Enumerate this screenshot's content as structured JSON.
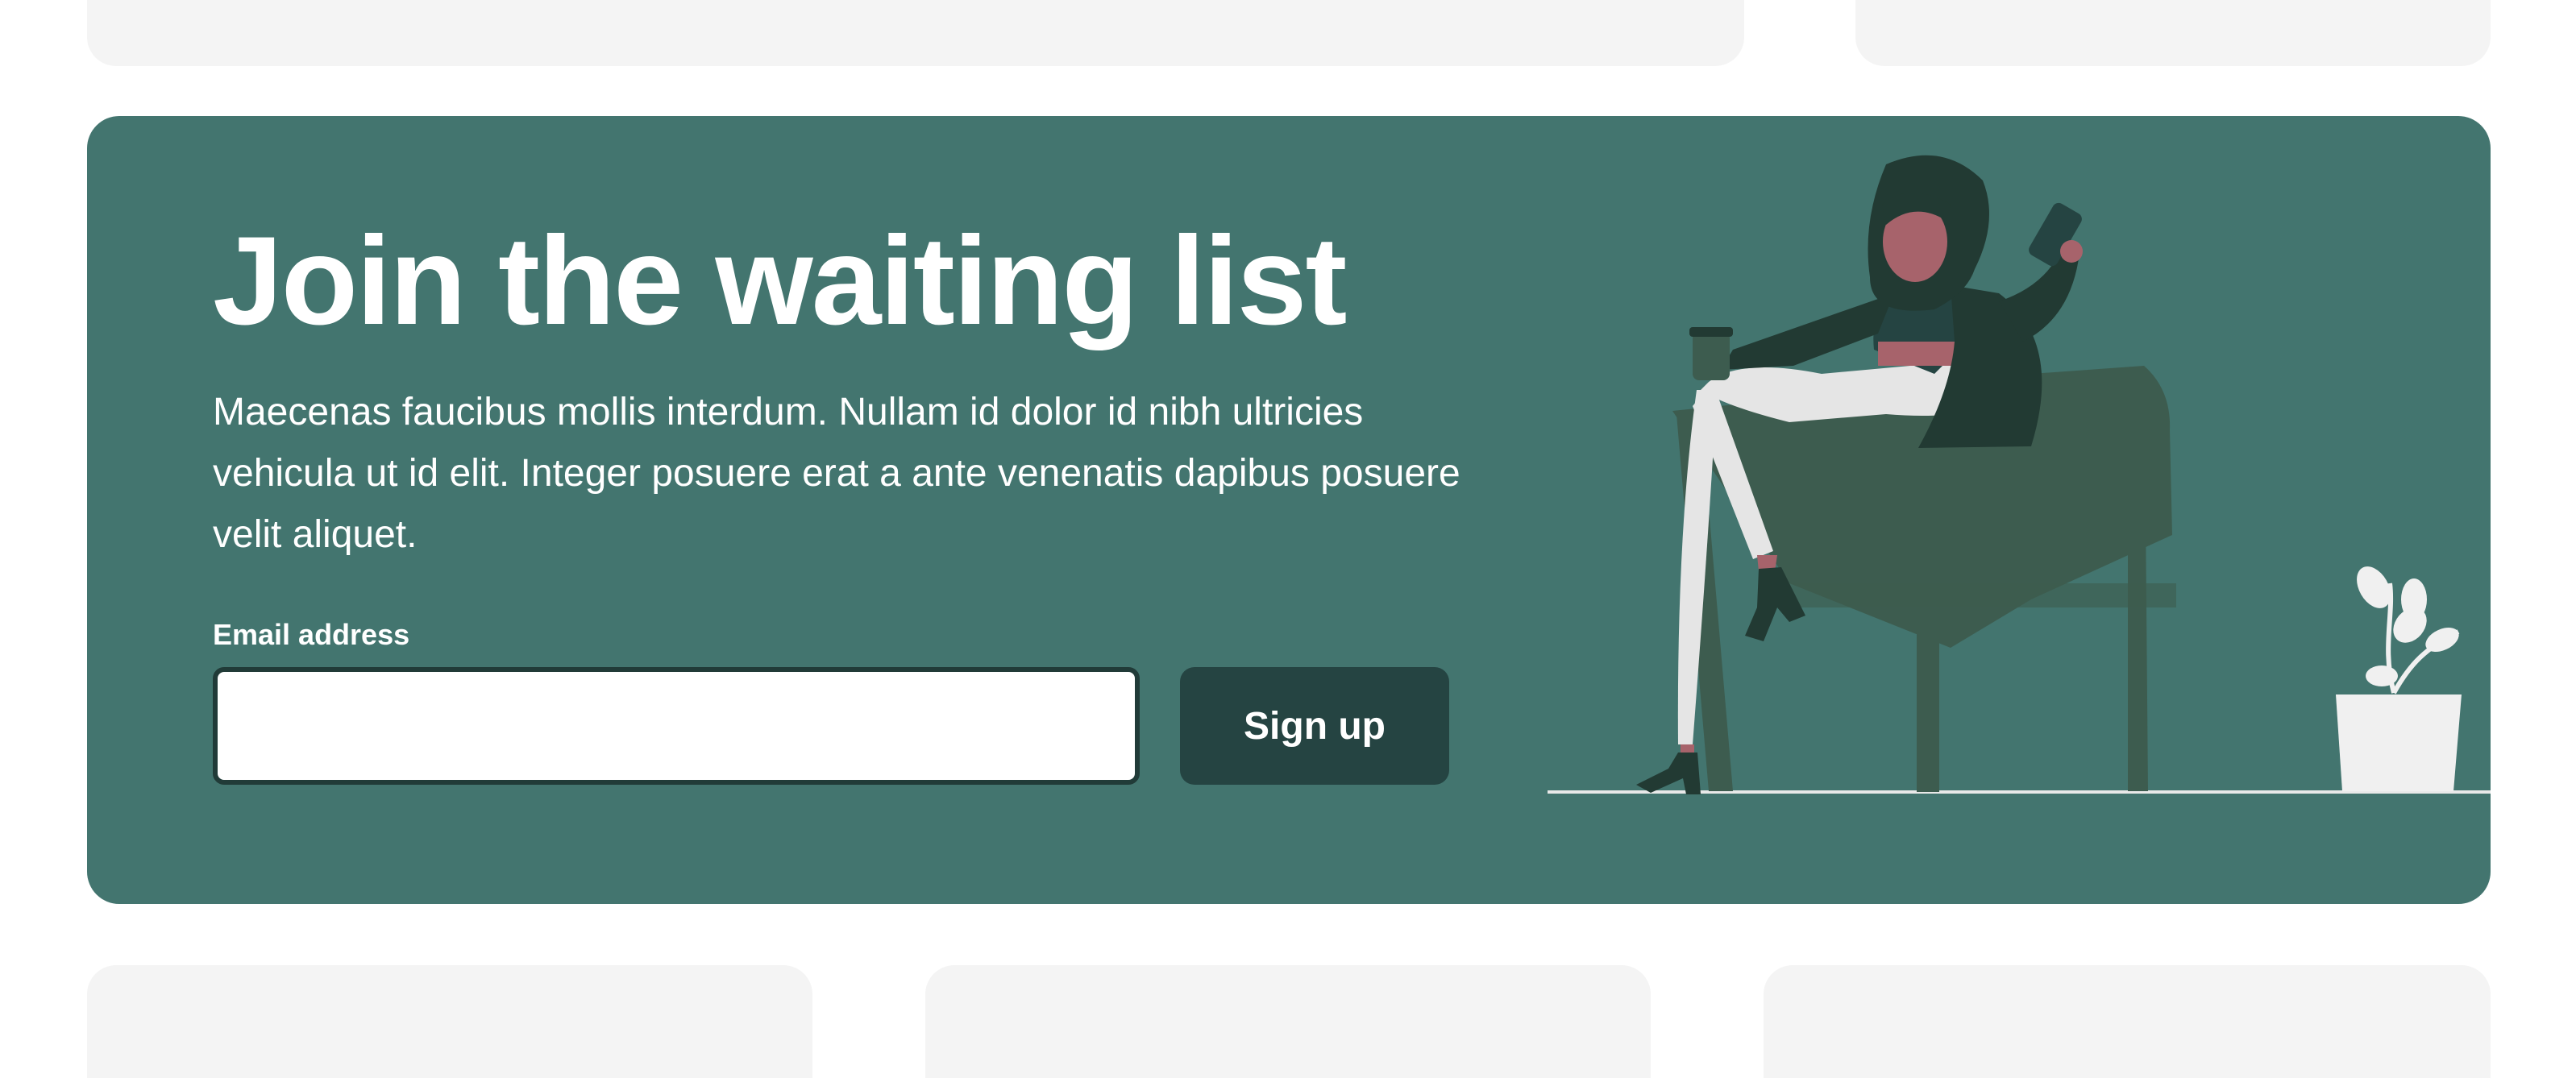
{
  "banner": {
    "title": "Join the waiting list",
    "description": "Maecenas faucibus mollis interdum. Nullam id dolor id nibh ultricies vehicula ut id elit. Integer posuere erat a ante venenatis dapibus posuere velit aliquet.",
    "email_label": "Email address",
    "email_value": "",
    "email_placeholder": "",
    "signup_label": "Sign up",
    "illustration_icon": "woman-on-chair-illustration"
  },
  "colors": {
    "banner_bg": "#43756f",
    "button_bg": "#254442",
    "input_border": "#213b38",
    "placeholder_card": "#f4f4f4"
  }
}
